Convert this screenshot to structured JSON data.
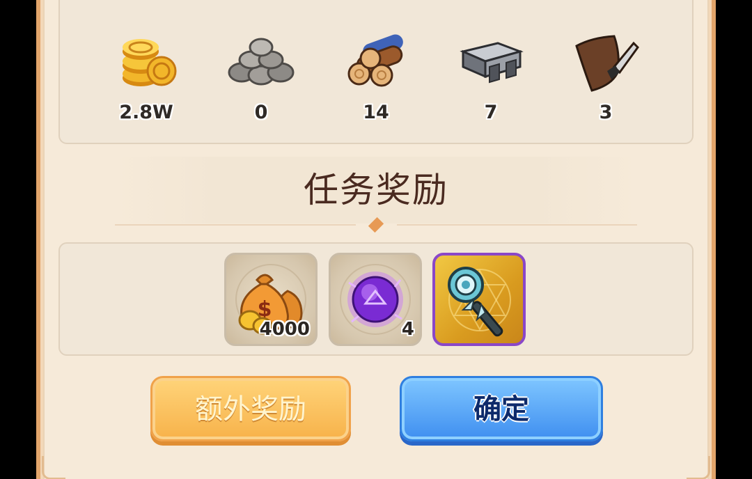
{
  "resources": [
    {
      "icon": "gold-coins-icon",
      "value": "2.8W"
    },
    {
      "icon": "stone-icon",
      "value": "0"
    },
    {
      "icon": "wood-logs-icon",
      "value": "14"
    },
    {
      "icon": "iron-ingot-icon",
      "value": "7"
    },
    {
      "icon": "leather-icon",
      "value": "3"
    }
  ],
  "title": "任务奖励",
  "rewards": [
    {
      "icon": "money-bag-icon",
      "count": "4000"
    },
    {
      "icon": "purple-orb-icon",
      "count": "4"
    },
    {
      "icon": "magic-staff-icon",
      "count": ""
    }
  ],
  "buttons": {
    "extra_label": "额外奖励",
    "confirm_label": "确定"
  },
  "colors": {
    "panel_bg": "#f6ead9",
    "panel_border": "#e2a56b",
    "extra_button": "#f7b24a",
    "confirm_button": "#3f8ff0",
    "legendary_frame": "#8a47c8"
  }
}
